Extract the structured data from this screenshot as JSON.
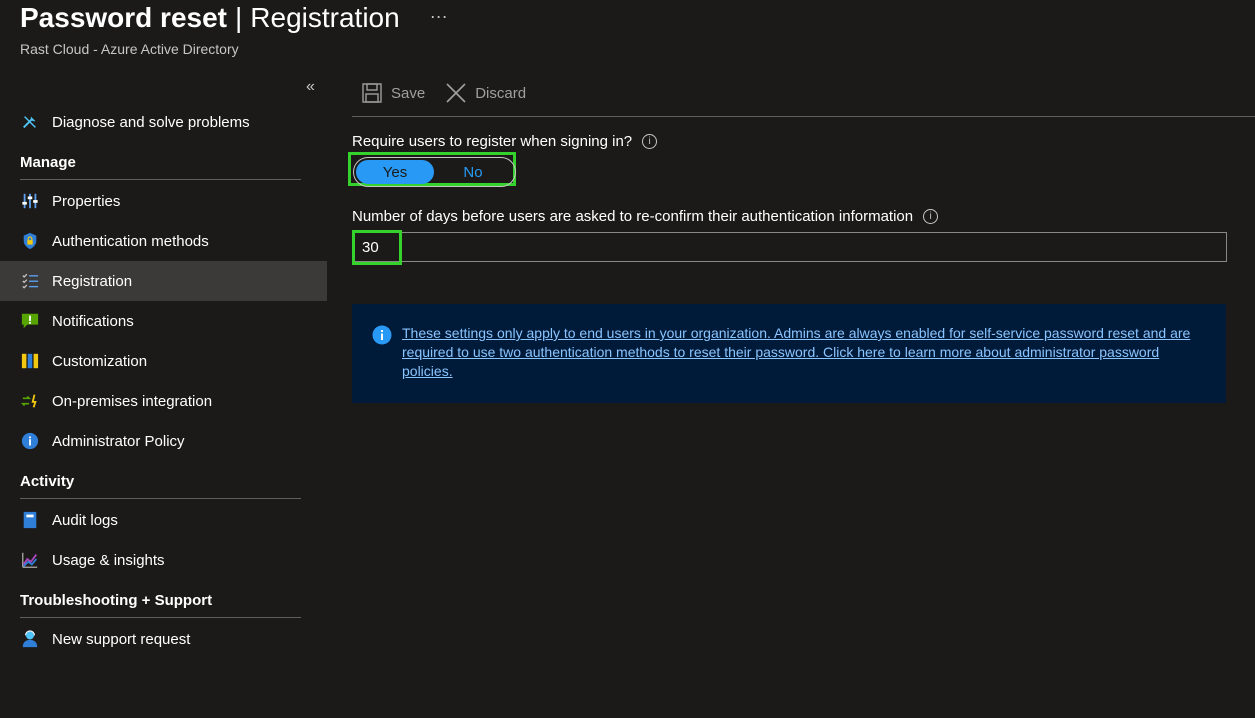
{
  "header": {
    "title_bold": "Password reset",
    "separator": "|",
    "title_light": "Registration",
    "more": "···",
    "subtitle": "Rast Cloud - Azure Active Directory"
  },
  "sidebar": {
    "collapse_glyph": "«",
    "top_items": [
      {
        "label": "Diagnose and solve problems",
        "icon": "wrench-icon"
      }
    ],
    "sections": [
      {
        "title": "Manage",
        "items": [
          {
            "label": "Properties",
            "icon": "properties-icon"
          },
          {
            "label": "Authentication methods",
            "icon": "shield-icon"
          },
          {
            "label": "Registration",
            "icon": "checklist-icon",
            "selected": true
          },
          {
            "label": "Notifications",
            "icon": "notification-icon"
          },
          {
            "label": "Customization",
            "icon": "customization-icon"
          },
          {
            "label": "On-premises integration",
            "icon": "sync-icon"
          },
          {
            "label": "Administrator Policy",
            "icon": "info-icon"
          }
        ]
      },
      {
        "title": "Activity",
        "items": [
          {
            "label": "Audit logs",
            "icon": "audit-log-icon"
          },
          {
            "label": "Usage & insights",
            "icon": "chart-icon"
          }
        ]
      },
      {
        "title": "Troubleshooting + Support",
        "items": [
          {
            "label": "New support request",
            "icon": "support-person-icon"
          }
        ]
      }
    ]
  },
  "toolbar": {
    "save_label": "Save",
    "discard_label": "Discard"
  },
  "form": {
    "require_register_label": "Require users to register when signing in?",
    "toggle_yes": "Yes",
    "toggle_no": "No",
    "toggle_selected": "Yes",
    "days_label": "Number of days before users are asked to re-confirm their authentication information",
    "days_value": "30",
    "info_glyph": "i"
  },
  "info_box": {
    "text": "These settings only apply to end users in your organization. Admins are always enabled for self-service password reset and are required to use two authentication methods to reset their password. Click here to learn more about administrator password policies."
  },
  "colors": {
    "background": "#1b1a19",
    "accent": "#2899f5",
    "highlight": "#35d12c",
    "info_bg": "#001a3a",
    "link": "#8ac5ff",
    "selected_bg": "#3b3a39"
  }
}
